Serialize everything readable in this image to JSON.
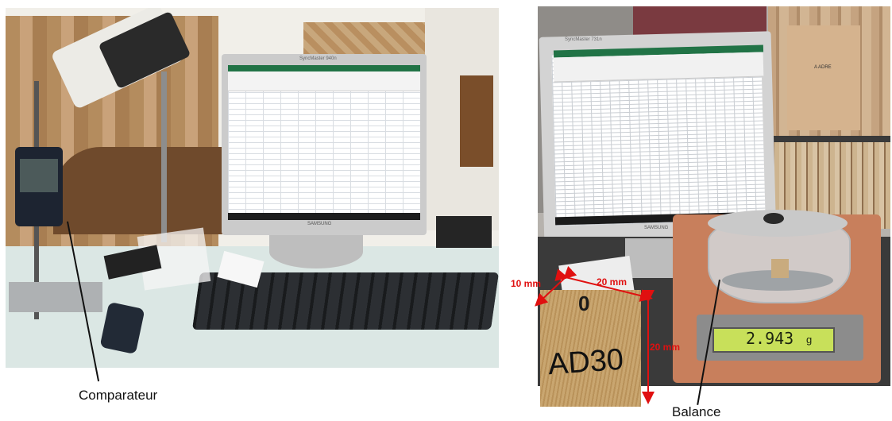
{
  "labels": {
    "left": "Comparateur",
    "right": "Balance"
  },
  "monitor": {
    "left_brand": "SAMSUNG",
    "left_model": "SyncMaster 940n",
    "right_brand": "SAMSUNG",
    "right_model": "SyncMaster 731n"
  },
  "balance": {
    "reading": "2.943",
    "unit": "g"
  },
  "sample": {
    "text": "AD30",
    "symbol": "0"
  },
  "dimensions": {
    "width": "20 mm",
    "depth": "10 mm",
    "height": "20 mm"
  },
  "shelf": {
    "box_label": "A ADRE"
  },
  "colors": {
    "annotation": "#e01010",
    "excel_green": "#217346",
    "balance_lcd": "#c8e05a"
  }
}
